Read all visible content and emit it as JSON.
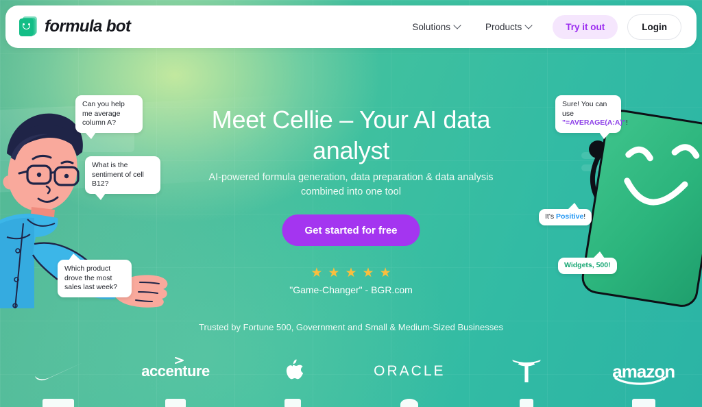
{
  "nav": {
    "brand_name": "formula bot",
    "brand_icon": "document-smiley-icon",
    "links": [
      {
        "label": "Solutions",
        "icon": "chevron-down-icon"
      },
      {
        "label": "Products",
        "icon": "chevron-down-icon"
      }
    ],
    "try_label": "Try it out",
    "login_label": "Login",
    "try_bg": "#f5e6fd",
    "try_color": "#9b2cf0"
  },
  "hero": {
    "headline": "Meet Cellie – Your AI data analyst",
    "subhead": "AI-powered formula generation, data preparation & data analysis combined into one tool",
    "cta_label": "Get started for free",
    "cta_color": "#a435f0",
    "stars": "★★★★★",
    "star_count": 5,
    "star_color": "#fbbe3d",
    "quote": "\"Game-Changer\" - BGR.com"
  },
  "bubbles": {
    "average": "Can you help me average column A?",
    "sentiment": "What is the sentiment of cell B12?",
    "product": "Which product drove the most sales last week?",
    "sure_prefix": "Sure! You can use ",
    "sure_formula": "\"=AVERAGE(A:A)\"",
    "sure_suffix": "!",
    "positive_prefix": "It's ",
    "positive_word": "Positive",
    "positive_suffix": "!",
    "widgets": "Widgets, 500!"
  },
  "trusted": {
    "text": "Trusted by Fortune 500, Government and Small & Medium-Sized Businesses",
    "logos": [
      {
        "name": "nike",
        "label": ""
      },
      {
        "name": "accenture",
        "label": "accenture"
      },
      {
        "name": "apple",
        "label": ""
      },
      {
        "name": "oracle",
        "label": "ORACLE"
      },
      {
        "name": "tesla",
        "label": ""
      },
      {
        "name": "amazon",
        "label": "amazon"
      }
    ]
  },
  "colors": {
    "background_start": "#55b793",
    "background_end": "#2bb4a5",
    "brand_green": "#13bd86",
    "cellie_green": "#2eb87e"
  }
}
